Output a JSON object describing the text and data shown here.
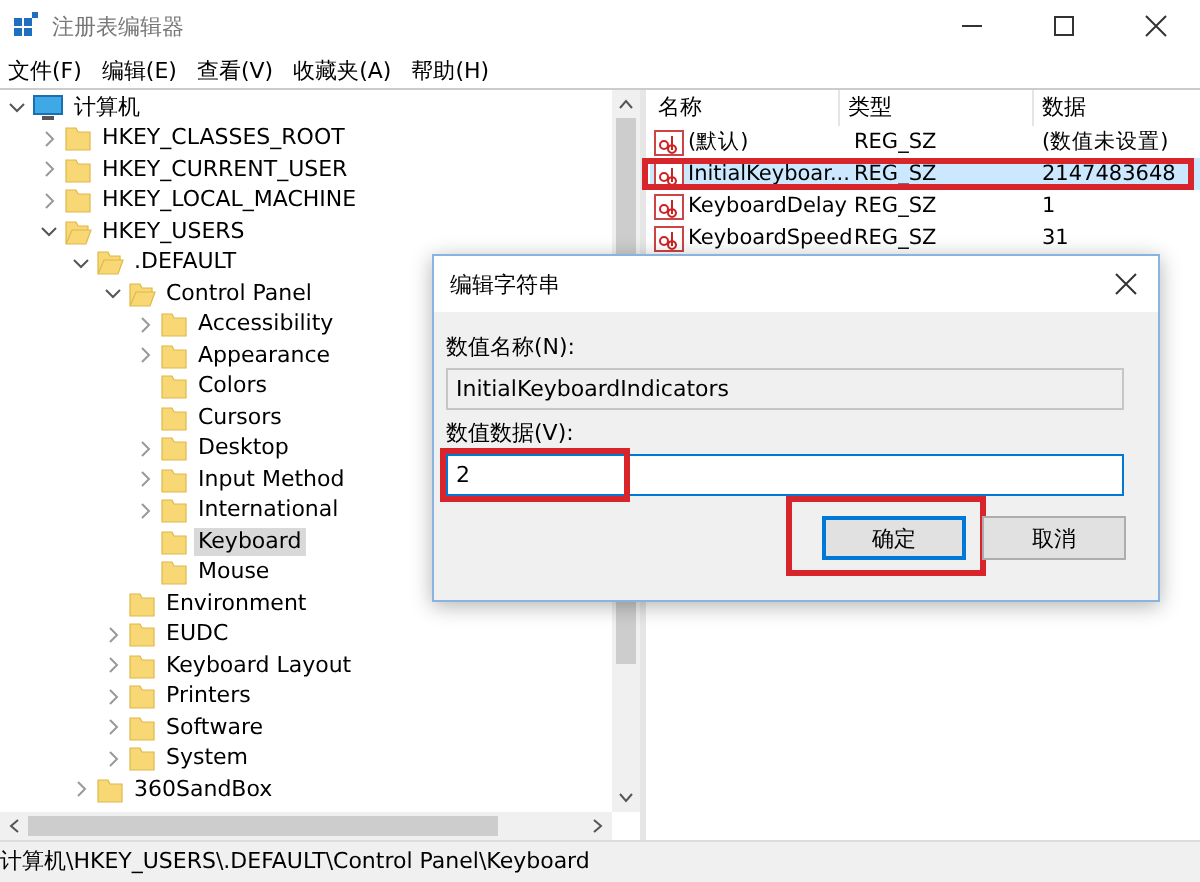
{
  "window": {
    "title": "注册表编辑器"
  },
  "menu": [
    "文件(F)",
    "编辑(E)",
    "查看(V)",
    "收藏夹(A)",
    "帮助(H)"
  ],
  "tree": {
    "label": "计算机",
    "kind": "computer",
    "expanded": true,
    "has_children": true,
    "selected": false,
    "children": [
      {
        "label": "HKEY_CLASSES_ROOT",
        "expanded": false,
        "has_children": true,
        "selected": false
      },
      {
        "label": "HKEY_CURRENT_USER",
        "expanded": false,
        "has_children": true,
        "selected": false
      },
      {
        "label": "HKEY_LOCAL_MACHINE",
        "expanded": false,
        "has_children": true,
        "selected": false
      },
      {
        "label": "HKEY_USERS",
        "expanded": true,
        "has_children": true,
        "selected": false,
        "children": [
          {
            "label": ".DEFAULT",
            "expanded": true,
            "has_children": true,
            "selected": false,
            "children": [
              {
                "label": "Control Panel",
                "expanded": true,
                "has_children": true,
                "selected": false,
                "children": [
                  {
                    "label": "Accessibility",
                    "expanded": false,
                    "has_children": true,
                    "selected": false
                  },
                  {
                    "label": "Appearance",
                    "expanded": false,
                    "has_children": true,
                    "selected": false
                  },
                  {
                    "label": "Colors",
                    "selected": false
                  },
                  {
                    "label": "Cursors",
                    "selected": false
                  },
                  {
                    "label": "Desktop",
                    "expanded": false,
                    "has_children": true,
                    "selected": false
                  },
                  {
                    "label": "Input Method",
                    "expanded": false,
                    "has_children": true,
                    "selected": false
                  },
                  {
                    "label": "International",
                    "expanded": false,
                    "has_children": true,
                    "selected": false
                  },
                  {
                    "label": "Keyboard",
                    "selected": true
                  },
                  {
                    "label": "Mouse",
                    "selected": false
                  }
                ]
              },
              {
                "label": "Environment",
                "selected": false
              },
              {
                "label": "EUDC",
                "expanded": false,
                "has_children": true,
                "selected": false
              },
              {
                "label": "Keyboard Layout",
                "expanded": false,
                "has_children": true,
                "selected": false
              },
              {
                "label": "Printers",
                "expanded": false,
                "has_children": true,
                "selected": false
              },
              {
                "label": "Software",
                "expanded": false,
                "has_children": true,
                "selected": false
              },
              {
                "label": "System",
                "expanded": false,
                "has_children": true,
                "selected": false
              }
            ]
          },
          {
            "label": "360SandBox",
            "expanded": false,
            "has_children": true,
            "selected": false
          }
        ]
      }
    ]
  },
  "table": {
    "columns": [
      "名称",
      "类型",
      "数据"
    ],
    "rows": [
      {
        "name": "(默认)",
        "type": "REG_SZ",
        "data": "(数值未设置)",
        "selected": false,
        "highlighted": false
      },
      {
        "name": "InitialKeyboar...",
        "type": "REG_SZ",
        "data": "2147483648",
        "selected": true,
        "highlighted": true
      },
      {
        "name": "KeyboardDelay",
        "type": "REG_SZ",
        "data": "1",
        "selected": false,
        "highlighted": false
      },
      {
        "name": "KeyboardSpeed",
        "type": "REG_SZ",
        "data": "31",
        "selected": false,
        "highlighted": false
      }
    ]
  },
  "dialog": {
    "title": "编辑字符串",
    "name_label": "数值名称(N):",
    "name_value": "InitialKeyboardIndicators",
    "data_label": "数值数据(V):",
    "data_value": "2",
    "data_highlighted": true,
    "buttons": [
      {
        "label": "确定",
        "default": true,
        "highlighted": true
      },
      {
        "label": "取消",
        "default": false,
        "highlighted": false
      }
    ]
  },
  "status_bar": "计算机\\HKEY_USERS\\.DEFAULT\\Control Panel\\Keyboard"
}
